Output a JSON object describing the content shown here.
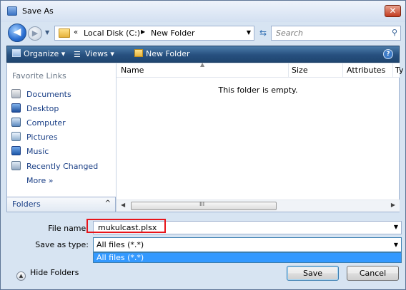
{
  "window": {
    "title": "Save As",
    "close_symbol": "✕"
  },
  "address": {
    "prefix": "«",
    "segments": [
      "Local Disk (C:)",
      "New Folder"
    ],
    "separator": "▶"
  },
  "search": {
    "placeholder": "Search"
  },
  "toolbar": {
    "organize_label": "Organize ▾",
    "views_label": "Views ▾",
    "new_folder_label": "New Folder",
    "help_symbol": "?"
  },
  "sidebar": {
    "favorite_links_title": "Favorite Links",
    "items": [
      {
        "label": "Documents",
        "icon": "documents-icon"
      },
      {
        "label": "Desktop",
        "icon": "desktop-icon"
      },
      {
        "label": "Computer",
        "icon": "computer-icon"
      },
      {
        "label": "Pictures",
        "icon": "pictures-icon"
      },
      {
        "label": "Music",
        "icon": "music-icon"
      },
      {
        "label": "Recently Changed",
        "icon": "recently-changed-icon"
      }
    ],
    "more_label": "More »",
    "folders_label": "Folders",
    "folders_chevron": "^"
  },
  "file_list": {
    "columns": [
      "Name",
      "Size",
      "Attributes",
      "Ty"
    ],
    "empty_message": "This folder is empty.",
    "scroll_grip": "III"
  },
  "form": {
    "file_name_label": "File name:",
    "file_name_value": "mukulcast.plsx",
    "save_as_type_label": "Save as type:",
    "save_as_type_value": "All files (*.*)",
    "save_as_type_options": [
      "All files (*.*)"
    ]
  },
  "footer": {
    "hide_folders_label": "Hide Folders",
    "save_label": "Save",
    "cancel_label": "Cancel"
  },
  "colors": {
    "toolbar_bg": "#27507f",
    "highlight_border": "#e8141a",
    "selected_option": "#3399ff",
    "link_text": "#1a3f86"
  }
}
